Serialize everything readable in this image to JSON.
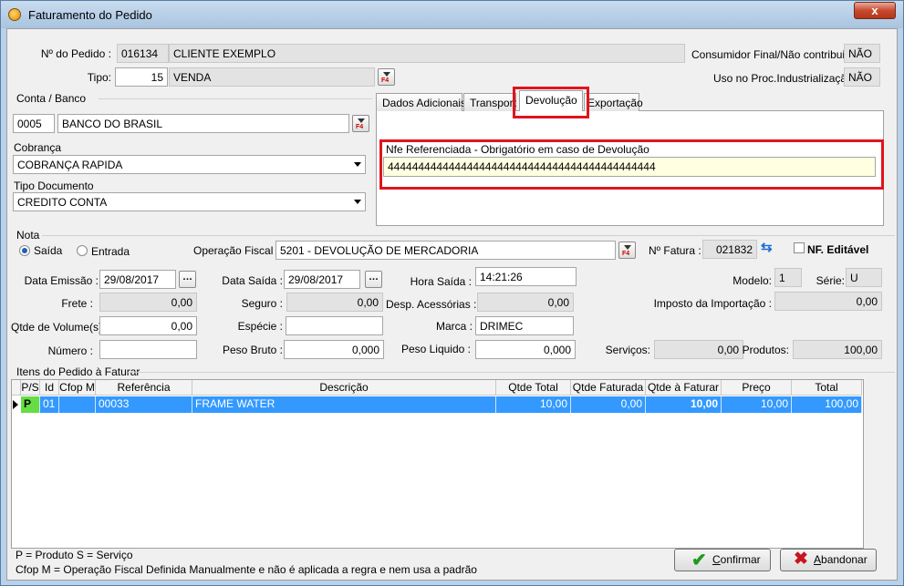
{
  "window": {
    "title": "Faturamento do Pedido",
    "close": "x"
  },
  "header": {
    "pedido_label": "Nº do Pedido :",
    "pedido_num": "016134",
    "cliente": "CLIENTE EXEMPLO",
    "consumidor_label": "Consumidor Final/Não contribuinte:",
    "consumidor_value": "NÃO",
    "tipo_label": "Tipo:",
    "tipo_num": "15",
    "tipo_desc": "VENDA",
    "uso_label": "Uso no Proc.Industrialização:",
    "uso_value": "NÃO"
  },
  "conta": {
    "group": "Conta / Banco",
    "code": "0005",
    "name": "BANCO DO BRASIL",
    "cobranca_label": "Cobrança",
    "cobranca_value": "COBRANÇA RAPIDA",
    "tipo_doc_label": "Tipo Documento",
    "tipo_doc_value": "CREDITO CONTA"
  },
  "tabs": {
    "items": [
      "Dados Adicionais",
      "Transport",
      "Devolução",
      "Exportação"
    ],
    "nfe_label": "Nfe Referenciada - Obrigatório em caso de Devolução",
    "nfe_value": "44444444444444444444444444444444444444444444"
  },
  "nota": {
    "group": "Nota",
    "saida": "Saída",
    "entrada": "Entrada",
    "operacao_label": "Operação Fiscal :",
    "operacao_value": "5201 - DEVOLUÇÃO DE MERCADORIA",
    "fatura_label": "Nº Fatura :",
    "fatura_value": "021832",
    "nf_editavel": "NF. Editável",
    "data_emissao_label": "Data Emissão :",
    "data_emissao": "29/08/2017",
    "data_saida_label": "Data Saída :",
    "data_saida": "29/08/2017",
    "hora_saida_label": "Hora Saída :",
    "hora_saida": "14:21:26",
    "modelo_label": "Modelo:",
    "modelo": "1",
    "serie_label": "Série:",
    "serie": "U",
    "frete_label": "Frete :",
    "frete": "0,00",
    "seguro_label": "Seguro :",
    "seguro": "0,00",
    "desp_label": "Desp. Acessórias :",
    "desp": "0,00",
    "imposto_label": "Imposto da Importação :",
    "imposto": "0,00",
    "volume_label": "Qtde de Volume(s) :",
    "volume": "0,00",
    "especie_label": "Espécie :",
    "especie": "",
    "marca_label": "Marca :",
    "marca": "DRIMEC",
    "numero_label": "Número :",
    "numero": "",
    "peso_bruto_label": "Peso Bruto :",
    "peso_bruto": "0,000",
    "peso_liquido_label": "Peso Liquido :",
    "peso_liquido": "0,000",
    "servicos_label": "Serviços:",
    "servicos": "0,00",
    "produtos_label": "Produtos:",
    "produtos": "100,00"
  },
  "itens": {
    "group": "Itens do Pedido à Faturar",
    "columns": [
      "P/S",
      "Id",
      "Cfop M",
      "Referência",
      "Descrição",
      "Qtde Total",
      "Qtde Faturada",
      "Qtde à Faturar",
      "Preço",
      "Total"
    ],
    "rows": [
      [
        "P",
        "01",
        "",
        "00033",
        "FRAME WATER",
        "10,00",
        "0,00",
        "10,00",
        "10,00",
        "100,00"
      ]
    ]
  },
  "footer": {
    "legend1": "P = Produto S = Serviço",
    "legend2": "Cfop M = Operação Fiscal Definida Manualmente e não é aplicada a regra e nem usa a padrão",
    "confirmar_u": "C",
    "confirmar_rest": "onfirmar",
    "abandonar_u": "A",
    "abandonar_rest": "bandonar"
  },
  "colors": {
    "highlight": "#e0141e",
    "selection": "#3399ff",
    "nfe_field": "#ffffe1"
  }
}
